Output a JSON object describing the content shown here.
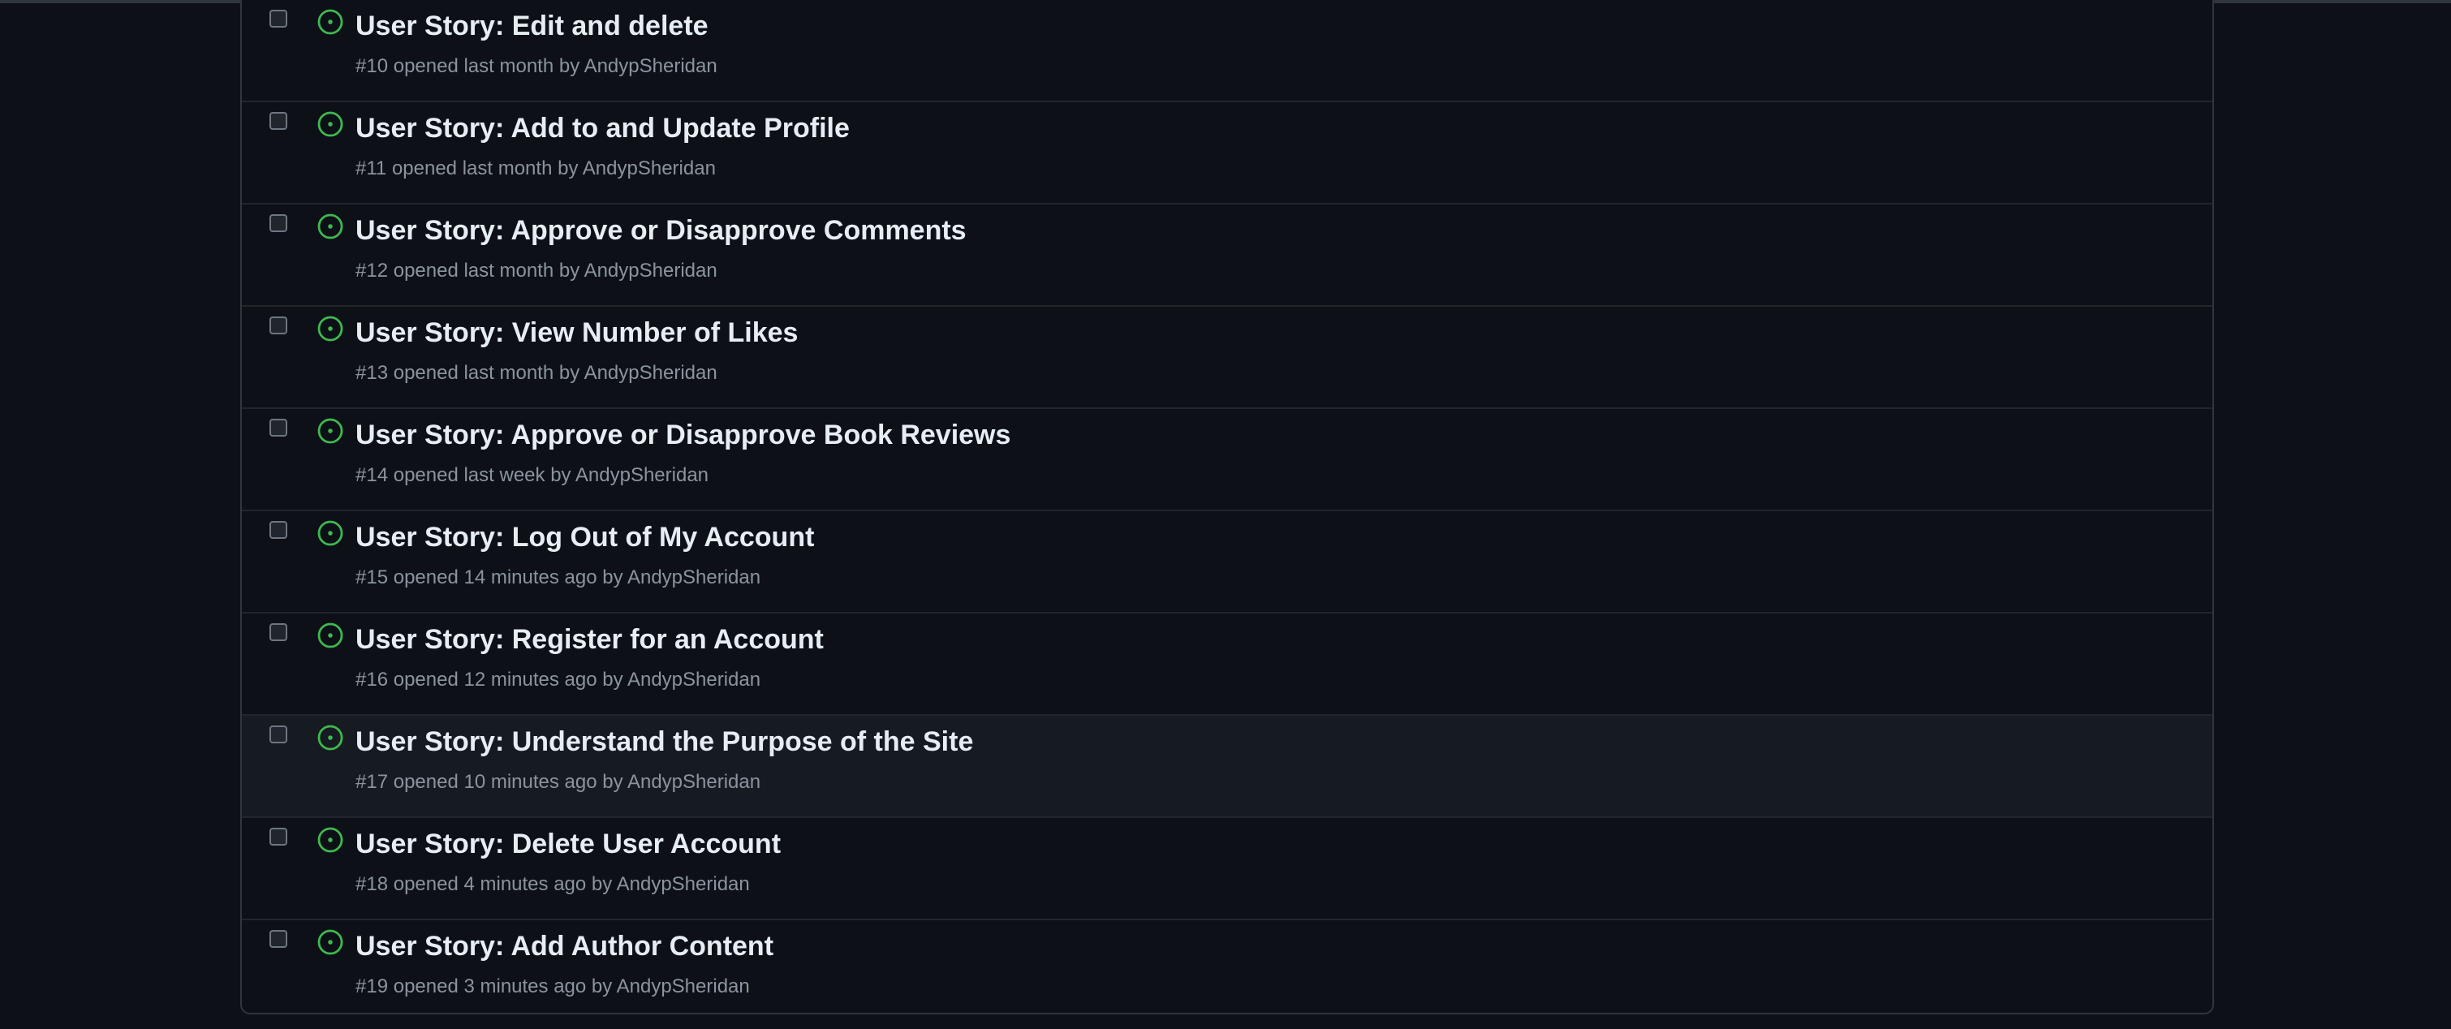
{
  "colors": {
    "background": "#0d1117",
    "border": "#30363d",
    "open_icon": "#3fb950",
    "title_text": "#e6edf3",
    "meta_text": "#8b949e"
  },
  "issues": [
    {
      "title": "User Story: Edit and delete",
      "number": "#10",
      "opened": "opened last month",
      "by": "by",
      "author": "AndypSheridan",
      "icon": "issue-opened-icon"
    },
    {
      "title": "User Story: Add to and Update Profile",
      "number": "#11",
      "opened": "opened last month",
      "by": "by",
      "author": "AndypSheridan",
      "icon": "issue-opened-icon"
    },
    {
      "title": "User Story: Approve or Disapprove Comments",
      "number": "#12",
      "opened": "opened last month",
      "by": "by",
      "author": "AndypSheridan",
      "icon": "issue-opened-icon"
    },
    {
      "title": "User Story: View Number of Likes",
      "number": "#13",
      "opened": "opened last month",
      "by": "by",
      "author": "AndypSheridan",
      "icon": "issue-opened-icon"
    },
    {
      "title": "User Story: Approve or Disapprove Book Reviews",
      "number": "#14",
      "opened": "opened last week",
      "by": "by",
      "author": "AndypSheridan",
      "icon": "issue-opened-icon"
    },
    {
      "title": "User Story: Log Out of My Account",
      "number": "#15",
      "opened": "opened 14 minutes ago",
      "by": "by",
      "author": "AndypSheridan",
      "icon": "issue-opened-icon"
    },
    {
      "title": "User Story: Register for an Account",
      "number": "#16",
      "opened": "opened 12 minutes ago",
      "by": "by",
      "author": "AndypSheridan",
      "icon": "issue-opened-icon"
    },
    {
      "title": "User Story: Understand the Purpose of the Site",
      "number": "#17",
      "opened": "opened 10 minutes ago",
      "by": "by",
      "author": "AndypSheridan",
      "icon": "issue-opened-icon"
    },
    {
      "title": "User Story: Delete User Account",
      "number": "#18",
      "opened": "opened 4 minutes ago",
      "by": "by",
      "author": "AndypSheridan",
      "icon": "issue-opened-icon"
    },
    {
      "title": "User Story: Add Author Content",
      "number": "#19",
      "opened": "opened 3 minutes ago",
      "by": "by",
      "author": "AndypSheridan",
      "icon": "issue-opened-icon"
    }
  ]
}
